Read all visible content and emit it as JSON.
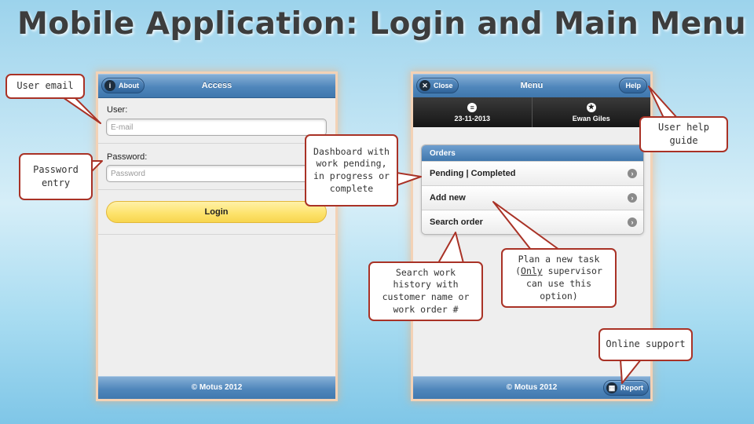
{
  "slide": {
    "title": "Mobile Application: Login and Main Menu"
  },
  "login_screen": {
    "about_button": "About",
    "about_icon": "info-icon",
    "title": "Access",
    "user_label": "User:",
    "email_placeholder": "E-mail",
    "password_label": "Password:",
    "password_placeholder": "Password",
    "login_button": "Login",
    "footer": "© Motus 2012"
  },
  "menu_screen": {
    "close_button": "Close",
    "close_icon": "close-icon",
    "title": "Menu",
    "help_button": "Help",
    "date_icon": "list-icon",
    "date": "23-11-2013",
    "user_icon": "star-icon",
    "user_name": "Ewan Giles",
    "orders_header": "Orders",
    "order_rows": [
      "Pending | Completed",
      "Add new",
      "Search order"
    ],
    "footer": "© Motus 2012",
    "report_button": "Report",
    "report_icon": "grid-icon"
  },
  "callouts": {
    "user_email": "User email",
    "password_entry": "Password entry",
    "dashboard": "Dashboard with work pending, in progress or complete",
    "user_help": "User help guide",
    "search_history": "Search work history with customer name or work order #",
    "plan_task_before": "Plan a new task (",
    "plan_task_only": "Only",
    "plan_task_after": " supervisor can use this option)",
    "online_support": "Online support"
  },
  "colors": {
    "callout_border": "#a93226",
    "header_blue": "#4f86bb",
    "login_yellow": "#fde26a",
    "title_gray": "#3d3d3d"
  }
}
